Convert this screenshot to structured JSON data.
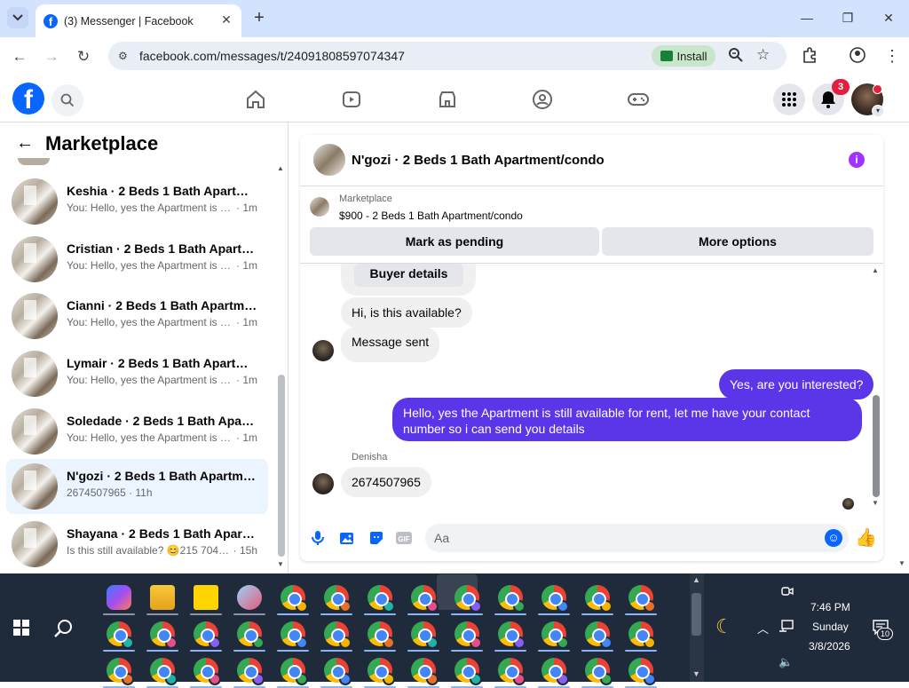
{
  "browser": {
    "tab_title": "(3) Messenger | Facebook",
    "url": "facebook.com/messages/t/24091808597074347",
    "install_label": "Install"
  },
  "facebook": {
    "notifications_count": "3"
  },
  "left": {
    "title": "Marketplace",
    "conversations": [
      {
        "name": "Keshia · 2 Beds 1 Bath Apartmen...",
        "preview": "You: Hello, yes the Apartment is sti...",
        "time": "· 1m"
      },
      {
        "name": "Cristian · 2 Beds 1 Bath Apartme...",
        "preview": "You: Hello, yes the Apartment is sti...",
        "time": "· 1m"
      },
      {
        "name": "Cianni · 2 Beds 1 Bath Apartmen...",
        "preview": "You: Hello, yes the Apartment is sti...",
        "time": "· 1m"
      },
      {
        "name": "Lymair · 2 Beds 1 Bath Apartme...",
        "preview": "You: Hello, yes the Apartment is sti...",
        "time": "· 1m"
      },
      {
        "name": "Soledade · 2 Beds 1 Bath Apart...",
        "preview": "You: Hello, yes the Apartment is sti...",
        "time": "· 1m"
      },
      {
        "name": "N'gozi · 2 Beds 1 Bath Apartmen...",
        "preview": "2674507965 · 11h",
        "time": ""
      },
      {
        "name": "Shayana · 2 Beds 1 Bath Apartm...",
        "preview": "Is this still available? 😊215 704 3...",
        "time": "· 15h"
      }
    ]
  },
  "chat": {
    "title": "N'gozi · 2 Beds 1 Bath Apartment/condo",
    "listing_source": "Marketplace",
    "listing_price": "$900 - 2 Beds 1 Bath Apartment/condo",
    "mark_pending": "Mark as pending",
    "more_options": "More options",
    "buyer_details": "Buyer details",
    "msg1": "Hi, is this available?",
    "msg2": "Message sent",
    "out1": "Yes, are you interested?",
    "out2": "Hello, yes the Apartment is still available for rent, let me have your contact number so i can send you details",
    "sender": "Denisha",
    "msg3": "2674507965",
    "composer_placeholder": "Aa"
  },
  "taskbar": {
    "time": "7:46 PM",
    "day": "Sunday",
    "date": "3/8/2026",
    "notif_count": "10"
  },
  "colors": {
    "accent": "#0866ff",
    "outgoing_bubble": "#5b36e8",
    "taskbar": "#1f2a3a"
  }
}
